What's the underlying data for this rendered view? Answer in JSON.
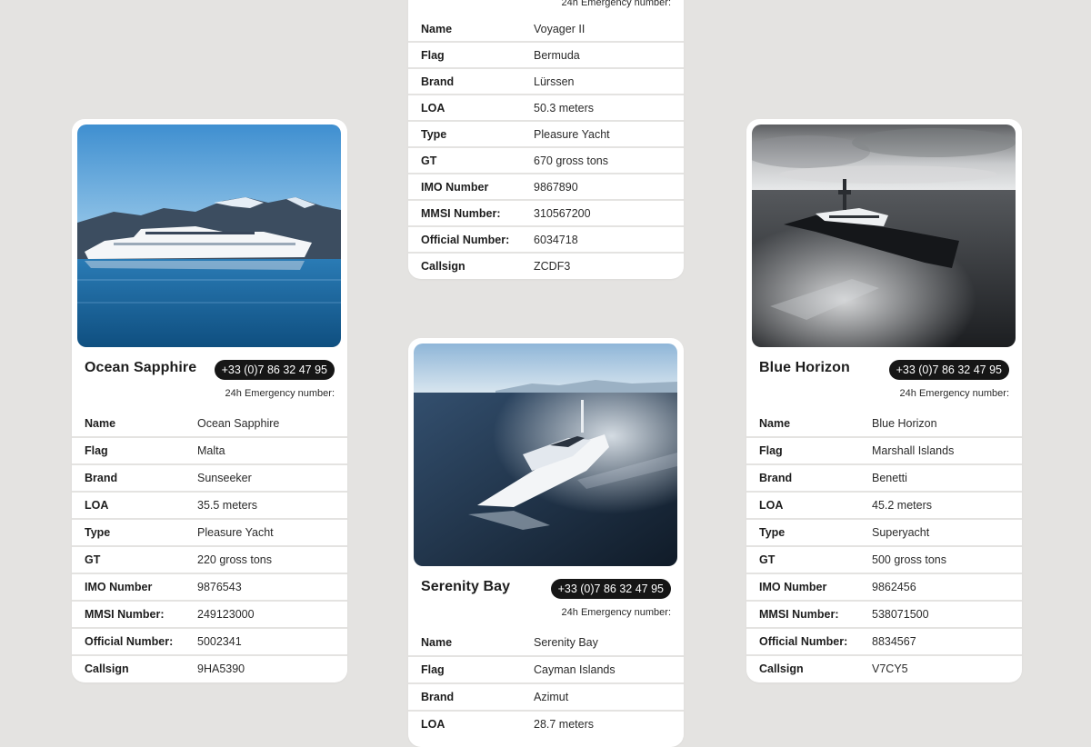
{
  "cards": {
    "voyager": {
      "emergency_label": "24h Emergency number:",
      "rows": [
        {
          "label": "Name",
          "value": "Voyager II"
        },
        {
          "label": "Flag",
          "value": "Bermuda"
        },
        {
          "label": "Brand",
          "value": "Lürssen"
        },
        {
          "label": "LOA",
          "value": "50.3 meters"
        },
        {
          "label": "Type",
          "value": "Pleasure Yacht"
        },
        {
          "label": "GT",
          "value": "670 gross tons"
        },
        {
          "label": "IMO Number",
          "value": "9867890"
        },
        {
          "label": "MMSI Number:",
          "value": "310567200"
        },
        {
          "label": "Official Number:",
          "value": "6034718"
        },
        {
          "label": "Callsign",
          "value": "ZCDF3"
        }
      ]
    },
    "ocean": {
      "title": "Ocean Sapphire",
      "phone": "+33 (0)7 86 32 47 95",
      "emergency_label": "24h Emergency number:",
      "rows": [
        {
          "label": "Name",
          "value": "Ocean Sapphire"
        },
        {
          "label": "Flag",
          "value": "Malta"
        },
        {
          "label": "Brand",
          "value": "Sunseeker"
        },
        {
          "label": "LOA",
          "value": "35.5 meters"
        },
        {
          "label": "Type",
          "value": "Pleasure Yacht"
        },
        {
          "label": "GT",
          "value": "220 gross tons"
        },
        {
          "label": "IMO Number",
          "value": "9876543"
        },
        {
          "label": "MMSI Number:",
          "value": "249123000"
        },
        {
          "label": "Official Number:",
          "value": "5002341"
        },
        {
          "label": "Callsign",
          "value": "9HA5390"
        }
      ]
    },
    "serenity": {
      "title": "Serenity Bay",
      "phone": "+33 (0)7 86 32 47 95",
      "emergency_label": "24h Emergency number:",
      "rows": [
        {
          "label": "Name",
          "value": "Serenity Bay"
        },
        {
          "label": "Flag",
          "value": "Cayman Islands"
        },
        {
          "label": "Brand",
          "value": "Azimut"
        },
        {
          "label": "LOA",
          "value": "28.7 meters"
        }
      ]
    },
    "blue": {
      "title": "Blue Horizon",
      "phone": "+33 (0)7 86 32 47 95",
      "emergency_label": "24h Emergency number:",
      "rows": [
        {
          "label": "Name",
          "value": "Blue Horizon"
        },
        {
          "label": "Flag",
          "value": "Marshall Islands"
        },
        {
          "label": "Brand",
          "value": "Benetti"
        },
        {
          "label": "LOA",
          "value": "45.2 meters"
        },
        {
          "label": "Type",
          "value": "Superyacht"
        },
        {
          "label": "GT",
          "value": "500 gross tons"
        },
        {
          "label": "IMO Number",
          "value": "9862456"
        },
        {
          "label": "MMSI Number:",
          "value": "538071500"
        },
        {
          "label": "Official Number:",
          "value": "8834567"
        },
        {
          "label": "Callsign",
          "value": "V7CY5"
        }
      ]
    }
  },
  "colors": {
    "background": "#e4e3e1",
    "card": "#ffffff",
    "phone_pill": "#161616",
    "text": "#1d1d1d"
  }
}
